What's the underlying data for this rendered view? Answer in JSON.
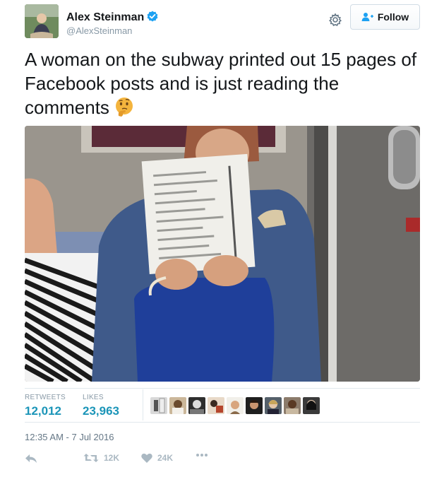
{
  "user": {
    "name": "Alex Steinman",
    "handle": "@AlexSteinman",
    "verified": true,
    "follow_label": "Follow"
  },
  "tweet": {
    "text": "A woman on the subway printed out 15 pages of Facebook posts and is just reading the comments",
    "emoji": "thinking-face-icon",
    "photo_alt": "photo"
  },
  "stats": {
    "retweets_label": "RETWEETS",
    "retweets_value": "12,012",
    "likes_label": "LIKES",
    "likes_value": "23,963",
    "liker_count": 9
  },
  "timestamp": "12:35 AM - 7 Jul 2016",
  "actions": {
    "retweet_count": "12K",
    "like_count": "24K"
  },
  "colors": {
    "accent": "#1b95b8",
    "muted": "#8899a6",
    "verified": "#1da1f2",
    "icon": "#aab8c2"
  }
}
